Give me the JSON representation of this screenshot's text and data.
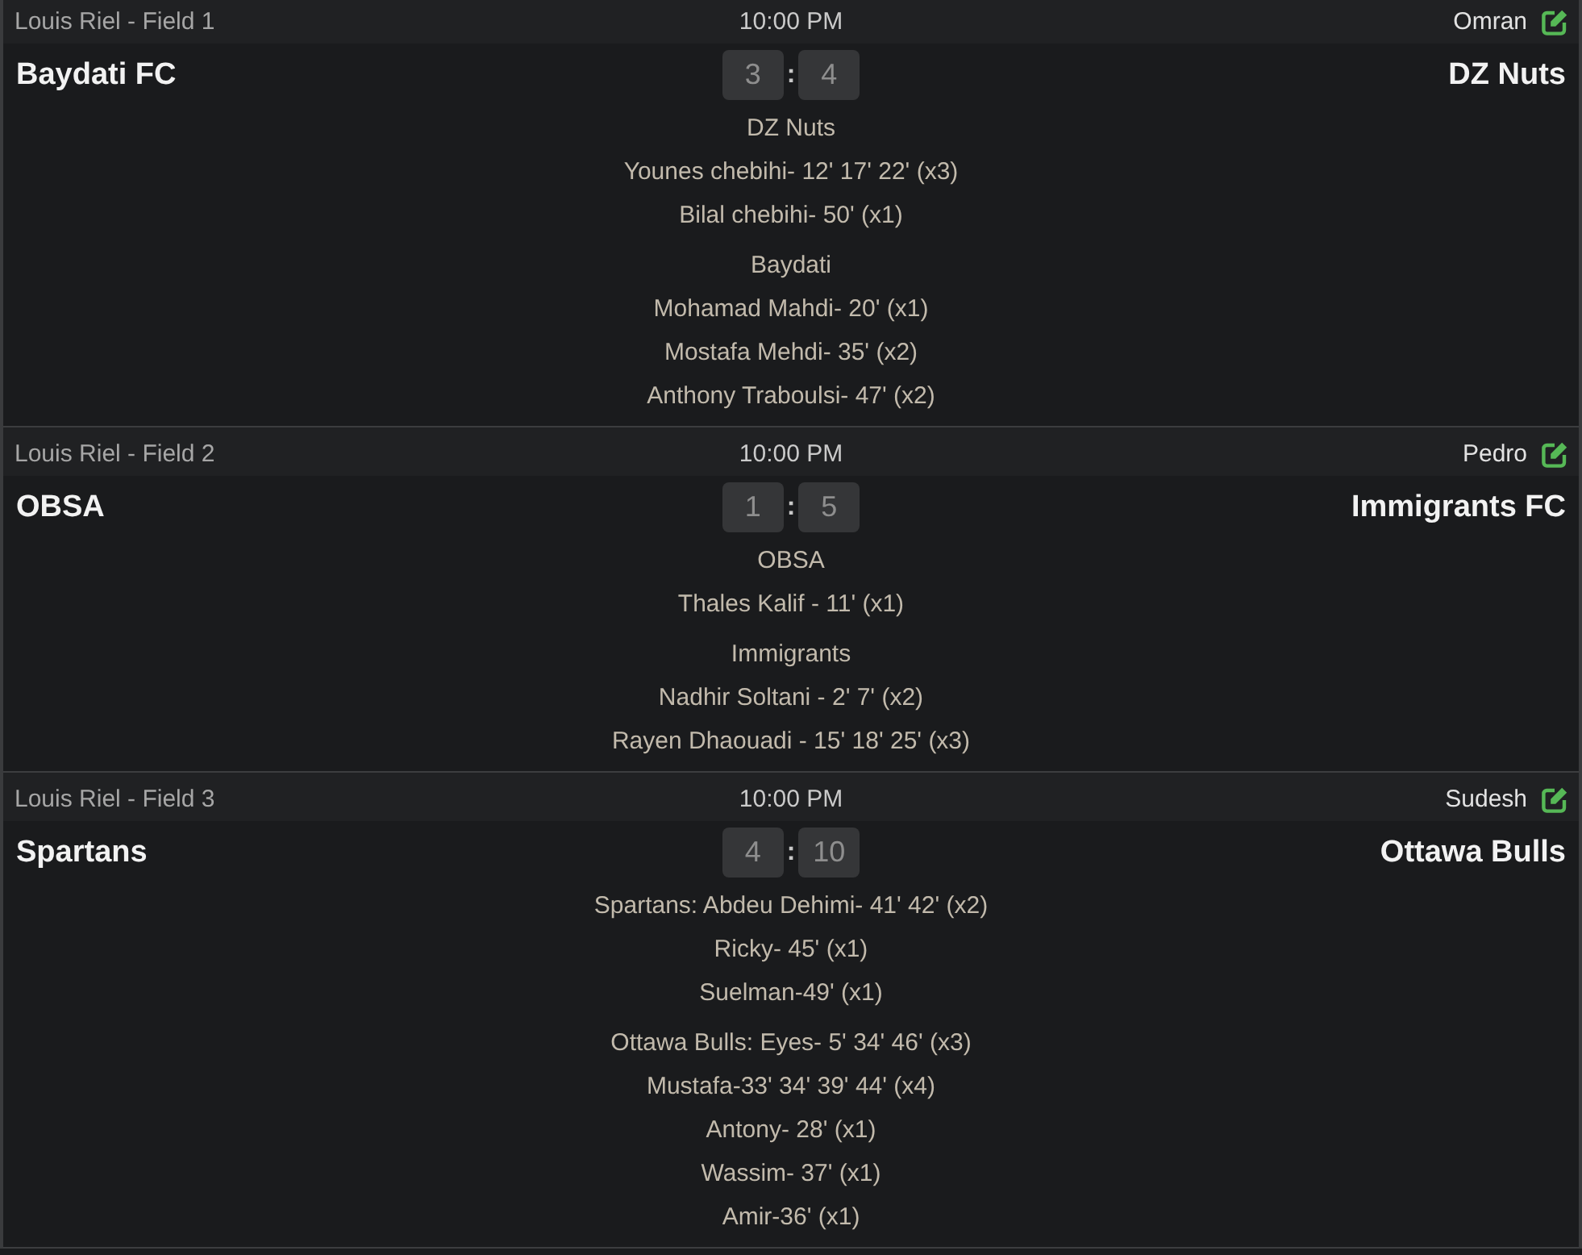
{
  "matches": [
    {
      "field": "Louis Riel - Field 1",
      "time": "10:00 PM",
      "referee": "Omran",
      "home": {
        "name": "Baydati FC",
        "score": "3"
      },
      "separator": ":",
      "away": {
        "name": "DZ Nuts",
        "score": "4"
      },
      "scorer_groups": [
        [
          "DZ Nuts",
          "Younes chebihi- 12' 17' 22' (x3)",
          "Bilal chebihi- 50' (x1)"
        ],
        [
          "Baydati",
          "Mohamad Mahdi- 20' (x1)",
          "Mostafa Mehdi- 35' (x2)",
          "Anthony Traboulsi- 47' (x2)"
        ]
      ]
    },
    {
      "field": "Louis Riel - Field 2",
      "time": "10:00 PM",
      "referee": "Pedro",
      "home": {
        "name": "OBSA",
        "score": "1"
      },
      "separator": ":",
      "away": {
        "name": "Immigrants FC",
        "score": "5"
      },
      "scorer_groups": [
        [
          "OBSA",
          "Thales Kalif - 11' (x1)"
        ],
        [
          "Immigrants",
          "Nadhir Soltani - 2' 7' (x2)",
          "Rayen Dhaouadi - 15' 18' 25' (x3)"
        ]
      ]
    },
    {
      "field": "Louis Riel - Field 3",
      "time": "10:00 PM",
      "referee": "Sudesh",
      "home": {
        "name": "Spartans",
        "score": "4"
      },
      "separator": ":",
      "away": {
        "name": "Ottawa Bulls",
        "score": "10"
      },
      "scorer_groups": [
        [
          "Spartans: Abdeu Dehimi- 41' 42' (x2)",
          "Ricky- 45' (x1)",
          "Suelman-49' (x1)"
        ],
        [
          "Ottawa Bulls: Eyes- 5' 34' 46' (x3)",
          "Mustafa-33' 34' 39' 44' (x4)",
          "Antony- 28' (x1)",
          "Wassim- 37' (x1)",
          "Amir-36' (x1)"
        ]
      ]
    }
  ]
}
